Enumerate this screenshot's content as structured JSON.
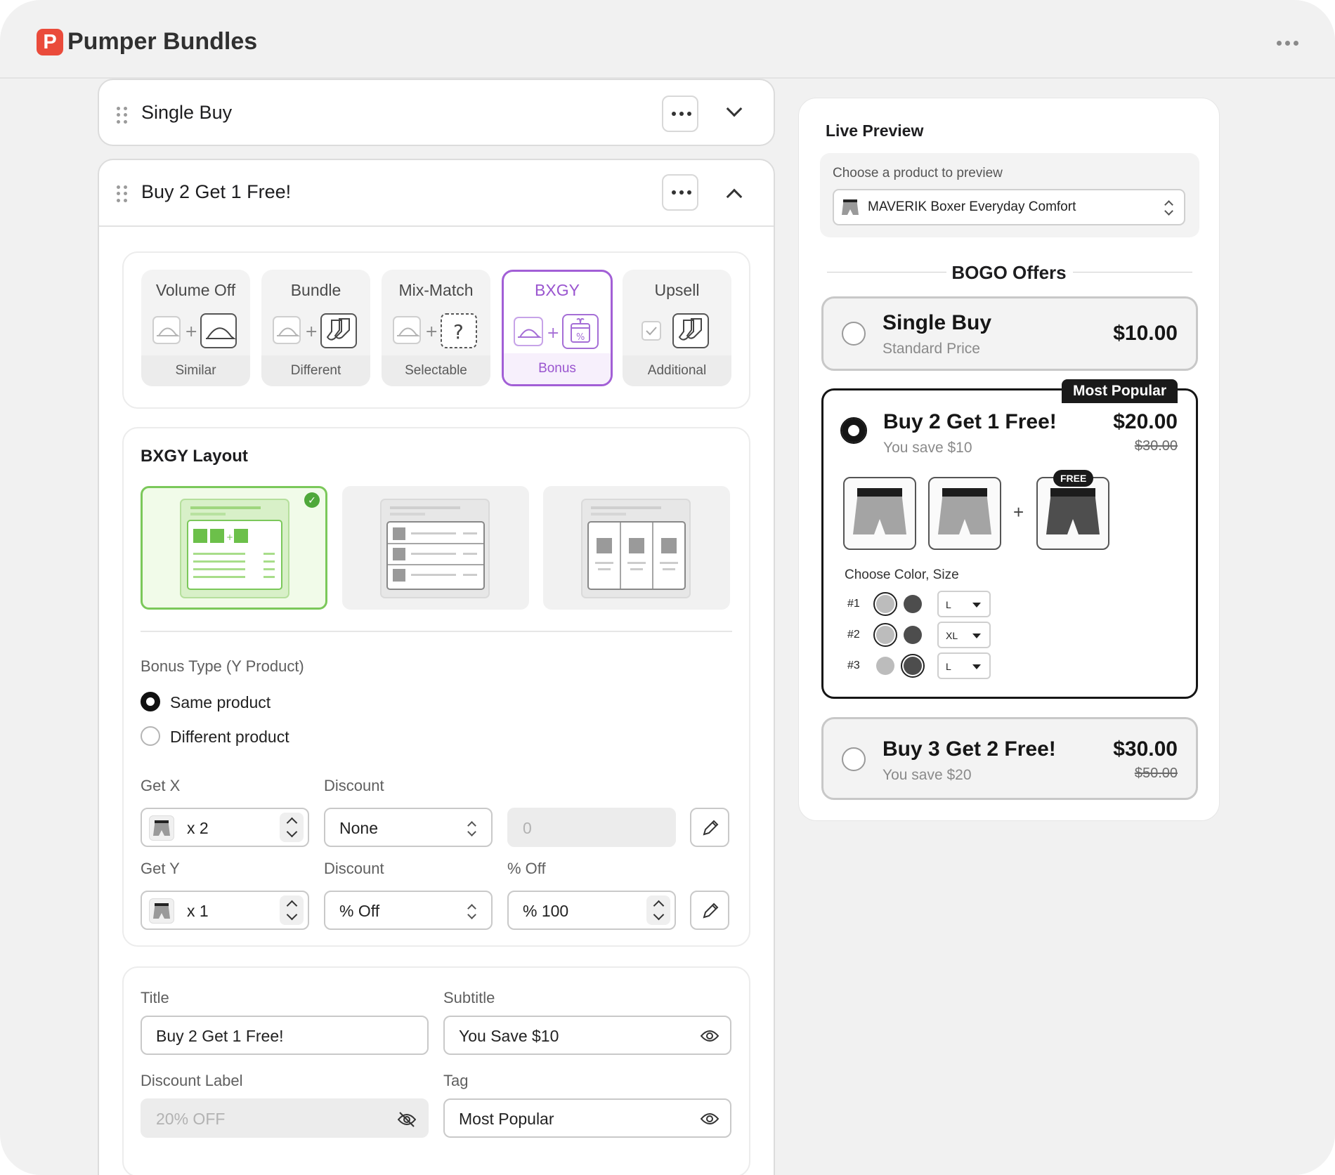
{
  "app": {
    "title": "Pumper Bundles",
    "logo_letter": "P"
  },
  "bundles": [
    {
      "title": "Single Buy",
      "state": "collapsed"
    },
    {
      "title": "Buy 2 Get 1 Free!",
      "state": "expanded"
    }
  ],
  "types": [
    {
      "label": "Volume Off",
      "sub": "Similar",
      "icon_a": "cap-icon",
      "icon_b": "cap-icon"
    },
    {
      "label": "Bundle",
      "sub": "Different",
      "icon_a": "cap-icon",
      "icon_b": "socks-icon"
    },
    {
      "label": "Mix-Match",
      "sub": "Selectable",
      "icon_a": "cap-icon",
      "icon_b": "question-icon",
      "glyph_b": "?"
    },
    {
      "label": "BXGY",
      "sub": "Bonus",
      "icon_a": "cap-icon",
      "icon_b": "gift-percent-icon",
      "selected": true
    },
    {
      "label": "Upsell",
      "sub": "Additional",
      "icon_a": "checkbox-icon",
      "icon_b": "socks-icon"
    }
  ],
  "layout_section": {
    "title": "BXGY Layout",
    "selected_index": 0
  },
  "bonus": {
    "label": "Bonus Type (Y Product)",
    "options": [
      "Same product",
      "Different product"
    ],
    "selected": 0
  },
  "get_x": {
    "label": "Get X",
    "qty": "x 2",
    "discount_label": "Discount",
    "discount": "None",
    "value_placeholder": "0"
  },
  "get_y": {
    "label": "Get Y",
    "qty": "x 1",
    "discount_label": "Discount",
    "discount": "% Off",
    "value_label": "% Off",
    "value": "% 100"
  },
  "texts": {
    "title_label": "Title",
    "title_value": "Buy 2 Get 1 Free!",
    "subtitle_label": "Subtitle",
    "subtitle_value": "You Save $10",
    "discount_label_label": "Discount Label",
    "discount_label_value": "20% OFF",
    "tag_label": "Tag",
    "tag_value": "Most Popular"
  },
  "preview": {
    "title": "Live Preview",
    "choose_label": "Choose a product to preview",
    "product": "MAVERIK Boxer Everyday Comfort",
    "heading": "BOGO Offers",
    "offers": [
      {
        "title": "Single Buy",
        "sub": "Standard Price",
        "price": "$10.00",
        "old": ""
      },
      {
        "title": "Buy 2 Get 1 Free!",
        "sub": "You save $10",
        "price": "$20.00",
        "old": "$30.00",
        "tag": "Most Popular",
        "selected": true
      },
      {
        "title": "Buy 3 Get 2 Free!",
        "sub": "You save $20",
        "price": "$30.00",
        "old": "$50.00"
      }
    ],
    "free_badge": "FREE",
    "plus": "+",
    "variant_label": "Choose Color, Size",
    "variants": [
      {
        "label": "#1",
        "size": "L",
        "selected_color": "light"
      },
      {
        "label": "#2",
        "size": "XL",
        "selected_color": "light"
      },
      {
        "label": "#3",
        "size": "L",
        "selected_color": "dark"
      }
    ]
  },
  "colors": {
    "accent": "#a25fd6",
    "brand": "#ea4b3b",
    "layout_selected": "#7bc85a",
    "swatch_light": "#bcbcbc",
    "swatch_dark": "#4d4d4d"
  }
}
